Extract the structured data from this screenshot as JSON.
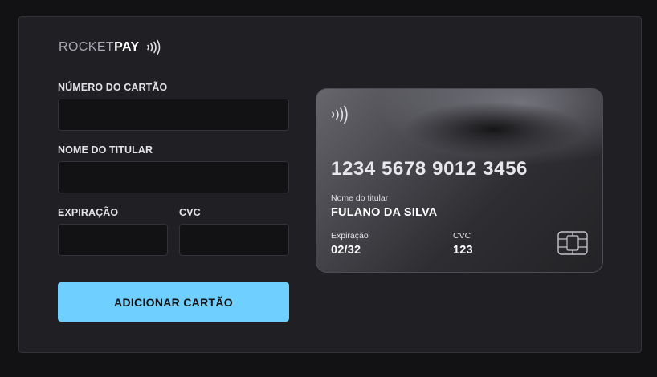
{
  "brand": {
    "part1": "ROCKET",
    "part2": "PAY"
  },
  "form": {
    "card_number_label": "NÚMERO DO CARTÃO",
    "card_number_value": "",
    "holder_label": "NOME DO TITULAR",
    "holder_value": "",
    "expiration_label": "EXPIRAÇÃO",
    "expiration_value": "",
    "cvc_label": "CVC",
    "cvc_value": "",
    "submit_label": "ADICIONAR CARTÃO"
  },
  "card": {
    "number": "1234 5678 9012 3456",
    "holder_caption": "Nome do titular",
    "holder_name": "FULANO DA SILVA",
    "expiration_caption": "Expiração",
    "expiration": "02/32",
    "cvc_caption": "CVC",
    "cvc": "123"
  },
  "colors": {
    "background": "#121214",
    "panel": "#202024",
    "accent": "#6fd0ff",
    "text": "#e1e1e6"
  },
  "icons": {
    "brand_icon": "contactless-icon",
    "card_icon": "contactless-icon",
    "chip": "chip-icon"
  }
}
